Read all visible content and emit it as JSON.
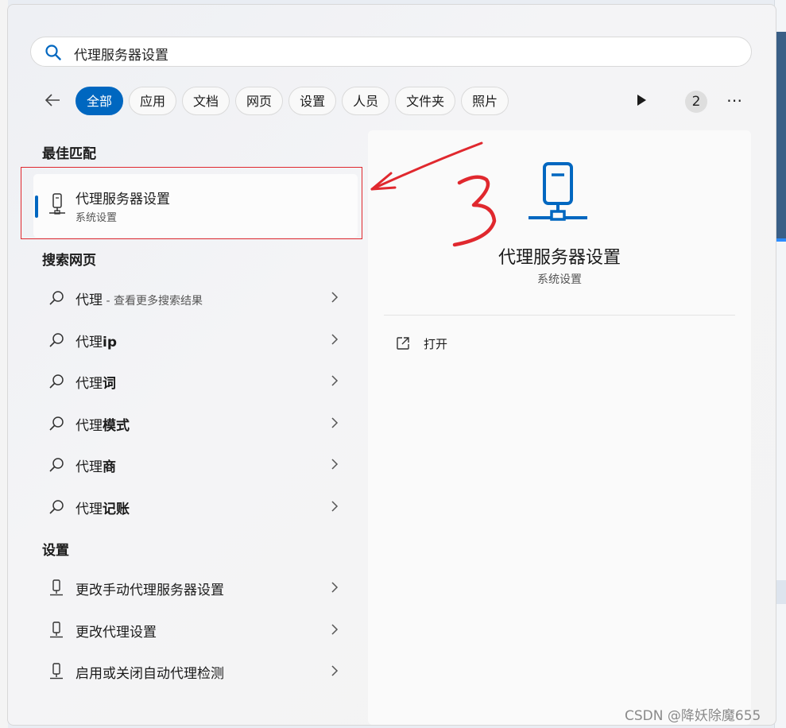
{
  "search": {
    "query": "代理服务器设置"
  },
  "tabs": [
    "全部",
    "应用",
    "文档",
    "网页",
    "设置",
    "人员",
    "文件夹",
    "照片"
  ],
  "active_tab_index": 0,
  "badge_count": "2",
  "best_match": {
    "section_title": "最佳匹配",
    "title": "代理服务器设置",
    "subtitle": "系统设置"
  },
  "web_search": {
    "section_title": "搜索网页",
    "items": [
      {
        "prefix": "代理",
        "bold": "",
        "hint": " - 查看更多搜索结果"
      },
      {
        "prefix": "代理",
        "bold": "ip",
        "hint": ""
      },
      {
        "prefix": "代理",
        "bold": "词",
        "hint": ""
      },
      {
        "prefix": "代理",
        "bold": "模式",
        "hint": ""
      },
      {
        "prefix": "代理",
        "bold": "商",
        "hint": ""
      },
      {
        "prefix": "代理",
        "bold": "记账",
        "hint": ""
      }
    ]
  },
  "settings": {
    "section_title": "设置",
    "items": [
      "更改手动代理服务器设置",
      "更改代理设置",
      "启用或关闭自动代理检测"
    ]
  },
  "preview": {
    "title": "代理服务器设置",
    "subtitle": "系统设置",
    "open_label": "打开"
  },
  "annotation": {
    "number": "3",
    "color": "#e0282e"
  },
  "watermark": "CSDN @降妖除魔655",
  "colors": {
    "accent": "#0067c0"
  }
}
